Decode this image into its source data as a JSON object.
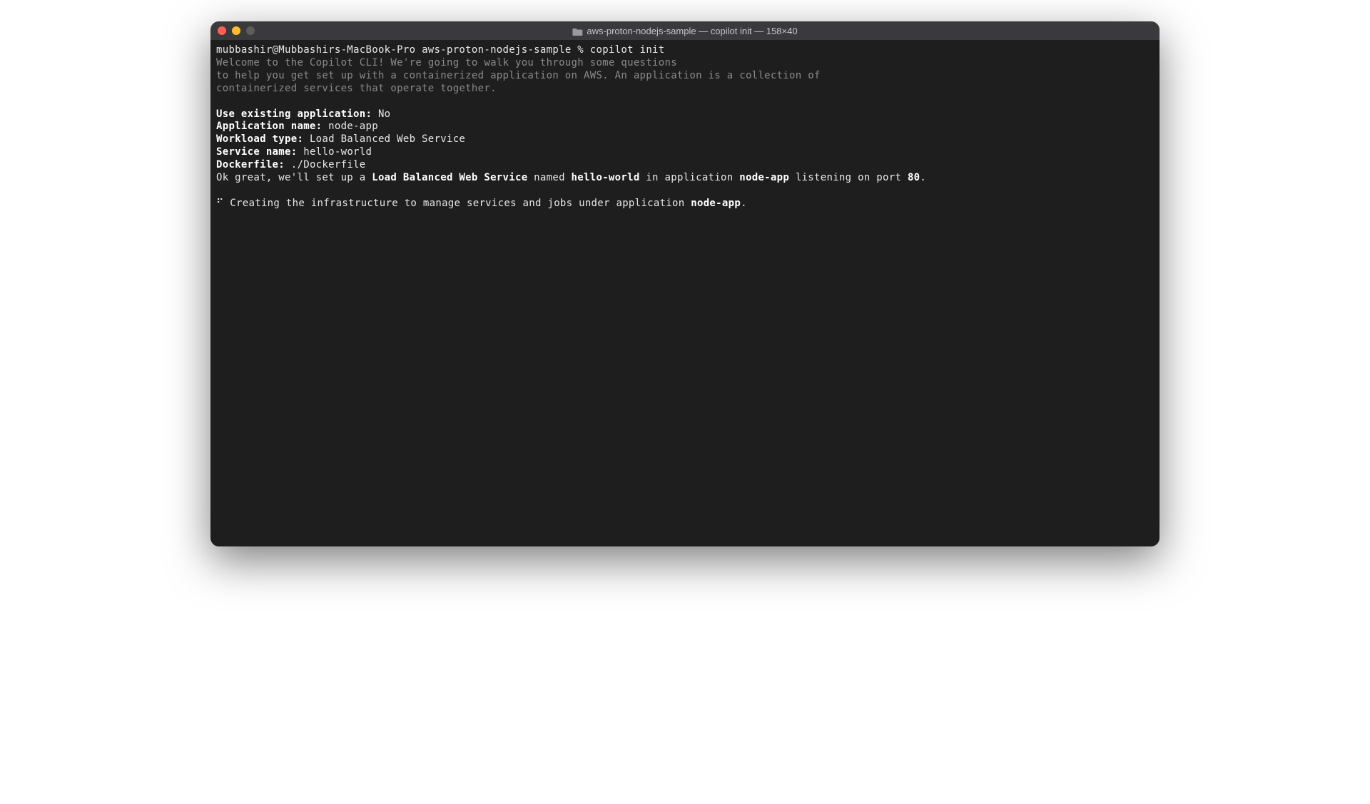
{
  "window": {
    "title": "aws-proton-nodejs-sample — copilot init — 158×40"
  },
  "prompt": {
    "user_host": "mubbashir@Mubbashirs-MacBook-Pro",
    "cwd": "aws-proton-nodejs-sample",
    "symbol": "%",
    "command": "copilot init"
  },
  "welcome": {
    "line1": "Welcome to the Copilot CLI! We're going to walk you through some questions",
    "line2": "to help you get set up with a containerized application on AWS. An application is a collection of",
    "line3": "containerized services that operate together."
  },
  "answers": {
    "use_existing_label": "Use existing application:",
    "use_existing_value": "No",
    "app_name_label": "Application name:",
    "app_name_value": "node-app",
    "workload_type_label": "Workload type:",
    "workload_type_value": "Load Balanced Web Service",
    "service_name_label": "Service name:",
    "service_name_value": "hello-world",
    "dockerfile_label": "Dockerfile:",
    "dockerfile_value": "./Dockerfile"
  },
  "confirm": {
    "prefix": "Ok great, we'll set up a ",
    "workload_type": "Load Balanced Web Service",
    "mid1": " named ",
    "service_name": "hello-world",
    "mid2": " in application ",
    "app_name": "node-app",
    "mid3": " listening on port ",
    "port": "80",
    "suffix": "."
  },
  "progress": {
    "spinner": "⠋",
    "text_prefix": "Creating the infrastructure to manage services and jobs under application ",
    "app_name": "node-app",
    "suffix": "."
  }
}
